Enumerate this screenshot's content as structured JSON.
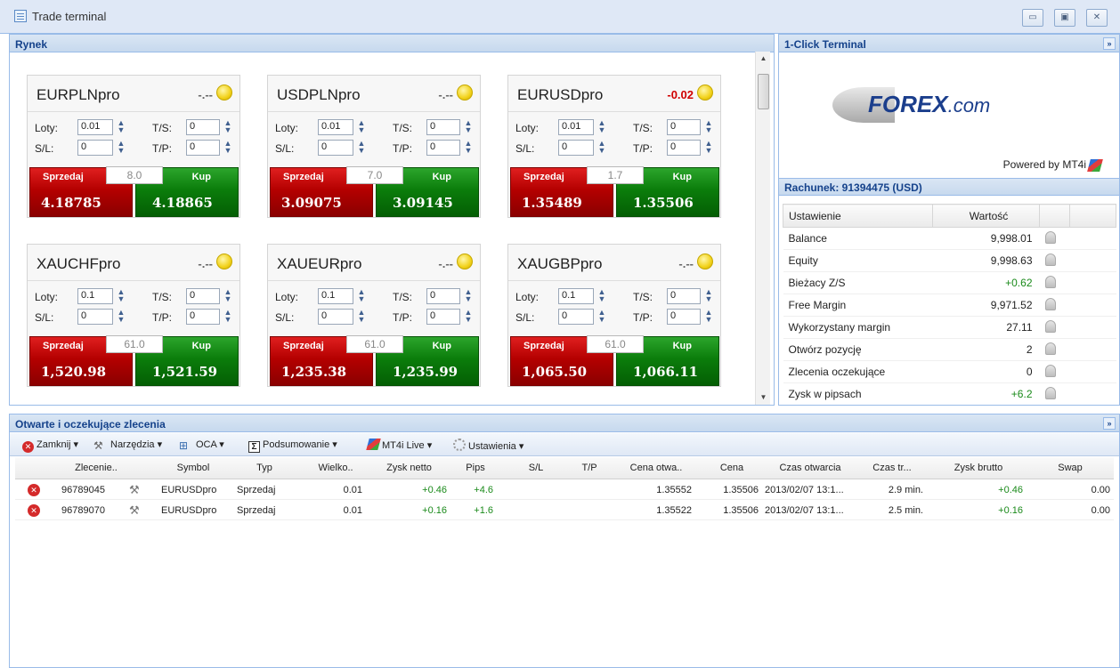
{
  "window": {
    "title": "Trade terminal",
    "controls": [
      "▭",
      "▣",
      "✕"
    ]
  },
  "market": {
    "header": "Rynek",
    "cards": [
      {
        "symbol": "EURPLNpro",
        "change": "-.--",
        "change_neg": false,
        "lots": "0.01",
        "ts": "0",
        "sl": "0",
        "tp": "0",
        "spread": "8.0",
        "sell_label": "Sprzedaj",
        "buy_label": "Kup",
        "sell_price": "4.18785",
        "buy_price": "4.18865"
      },
      {
        "symbol": "USDPLNpro",
        "change": "-.--",
        "change_neg": false,
        "lots": "0.01",
        "ts": "0",
        "sl": "0",
        "tp": "0",
        "spread": "7.0",
        "sell_label": "Sprzedaj",
        "buy_label": "Kup",
        "sell_price": "3.09075",
        "buy_price": "3.09145"
      },
      {
        "symbol": "EURUSDpro",
        "change": "-0.02",
        "change_neg": true,
        "lots": "0.01",
        "ts": "0",
        "sl": "0",
        "tp": "0",
        "spread": "1.7",
        "sell_label": "Sprzedaj",
        "buy_label": "Kup",
        "sell_price": "1.35489",
        "buy_price": "1.35506"
      },
      {
        "symbol": "XAUCHFpro",
        "change": "-.--",
        "change_neg": false,
        "lots": "0.1",
        "ts": "0",
        "sl": "0",
        "tp": "0",
        "spread": "61.0",
        "sell_label": "Sprzedaj",
        "buy_label": "Kup",
        "sell_price": "1,520.98",
        "buy_price": "1,521.59"
      },
      {
        "symbol": "XAUEURpro",
        "change": "-.--",
        "change_neg": false,
        "lots": "0.1",
        "ts": "0",
        "sl": "0",
        "tp": "0",
        "spread": "61.0",
        "sell_label": "Sprzedaj",
        "buy_label": "Kup",
        "sell_price": "1,235.38",
        "buy_price": "1,235.99"
      },
      {
        "symbol": "XAUGBPpro",
        "change": "-.--",
        "change_neg": false,
        "lots": "0.1",
        "ts": "0",
        "sl": "0",
        "tp": "0",
        "spread": "61.0",
        "sell_label": "Sprzedaj",
        "buy_label": "Kup",
        "sell_price": "1,065.50",
        "buy_price": "1,066.11"
      }
    ],
    "labels": {
      "lots": "Loty:",
      "ts": "T/S:",
      "sl": "S/L:",
      "tp": "T/P:"
    }
  },
  "terminal": {
    "header": "1-Click Terminal",
    "logo_main": "FOREX",
    "logo_suffix": ".com",
    "powered_by": "Powered by MT4i",
    "account_header": "Rachunek: 91394475 (USD)",
    "columns": [
      "Ustawienie",
      "Wartość"
    ],
    "rows": [
      {
        "name": "Balance",
        "value": "9,998.01",
        "positive": false
      },
      {
        "name": "Equity",
        "value": "9,998.63",
        "positive": false
      },
      {
        "name": "Bieżacy Z/S",
        "value": "+0.62",
        "positive": true
      },
      {
        "name": "Free Margin",
        "value": "9,971.52",
        "positive": false
      },
      {
        "name": "Wykorzystany margin",
        "value": "27.11",
        "positive": false
      },
      {
        "name": "Otwórz pozycję",
        "value": "2",
        "positive": false
      },
      {
        "name": "Zlecenia oczekujące",
        "value": "0",
        "positive": false
      },
      {
        "name": "Zysk w pipsach",
        "value": "+6.2",
        "positive": true
      }
    ]
  },
  "orders": {
    "header": "Otwarte i oczekujące zlecenia",
    "toolbar": {
      "close": "Zamknij ▾",
      "tools": "Narzędzia ▾",
      "oca": "OCA ▾",
      "summary": "Podsumowanie ▾",
      "mt4": "MT4i Live ▾",
      "settings": "Ustawienia ▾"
    },
    "columns": [
      "Zlecenie..",
      "Symbol",
      "Typ",
      "Wielko..",
      "Zysk netto",
      "Pips",
      "S/L",
      "T/P",
      "Cena otwa..",
      "Cena",
      "Czas otwarcia",
      "Czas tr...",
      "Zysk brutto",
      "Swap"
    ],
    "rows": [
      {
        "id": "96789045",
        "symbol": "EURUSDpro",
        "type": "Sprzedaj",
        "size": "0.01",
        "net": "+0.46",
        "pips": "+4.6",
        "sl": "",
        "tp": "",
        "open_price": "1.35552",
        "price": "1.35506",
        "open_time": "2013/02/07 13:1...",
        "duration": "2.9 min.",
        "gross": "+0.46",
        "swap": "0.00"
      },
      {
        "id": "96789070",
        "symbol": "EURUSDpro",
        "type": "Sprzedaj",
        "size": "0.01",
        "net": "+0.16",
        "pips": "+1.6",
        "sl": "",
        "tp": "",
        "open_price": "1.35522",
        "price": "1.35506",
        "open_time": "2013/02/07 13:1...",
        "duration": "2.5 min.",
        "gross": "+0.16",
        "swap": "0.00"
      }
    ]
  },
  "colors": {
    "panel_header": "#c7d9ee",
    "sell": "#b40000",
    "buy": "#0b7d0b",
    "positive": "#1a8a1a",
    "negative": "#d00000"
  }
}
